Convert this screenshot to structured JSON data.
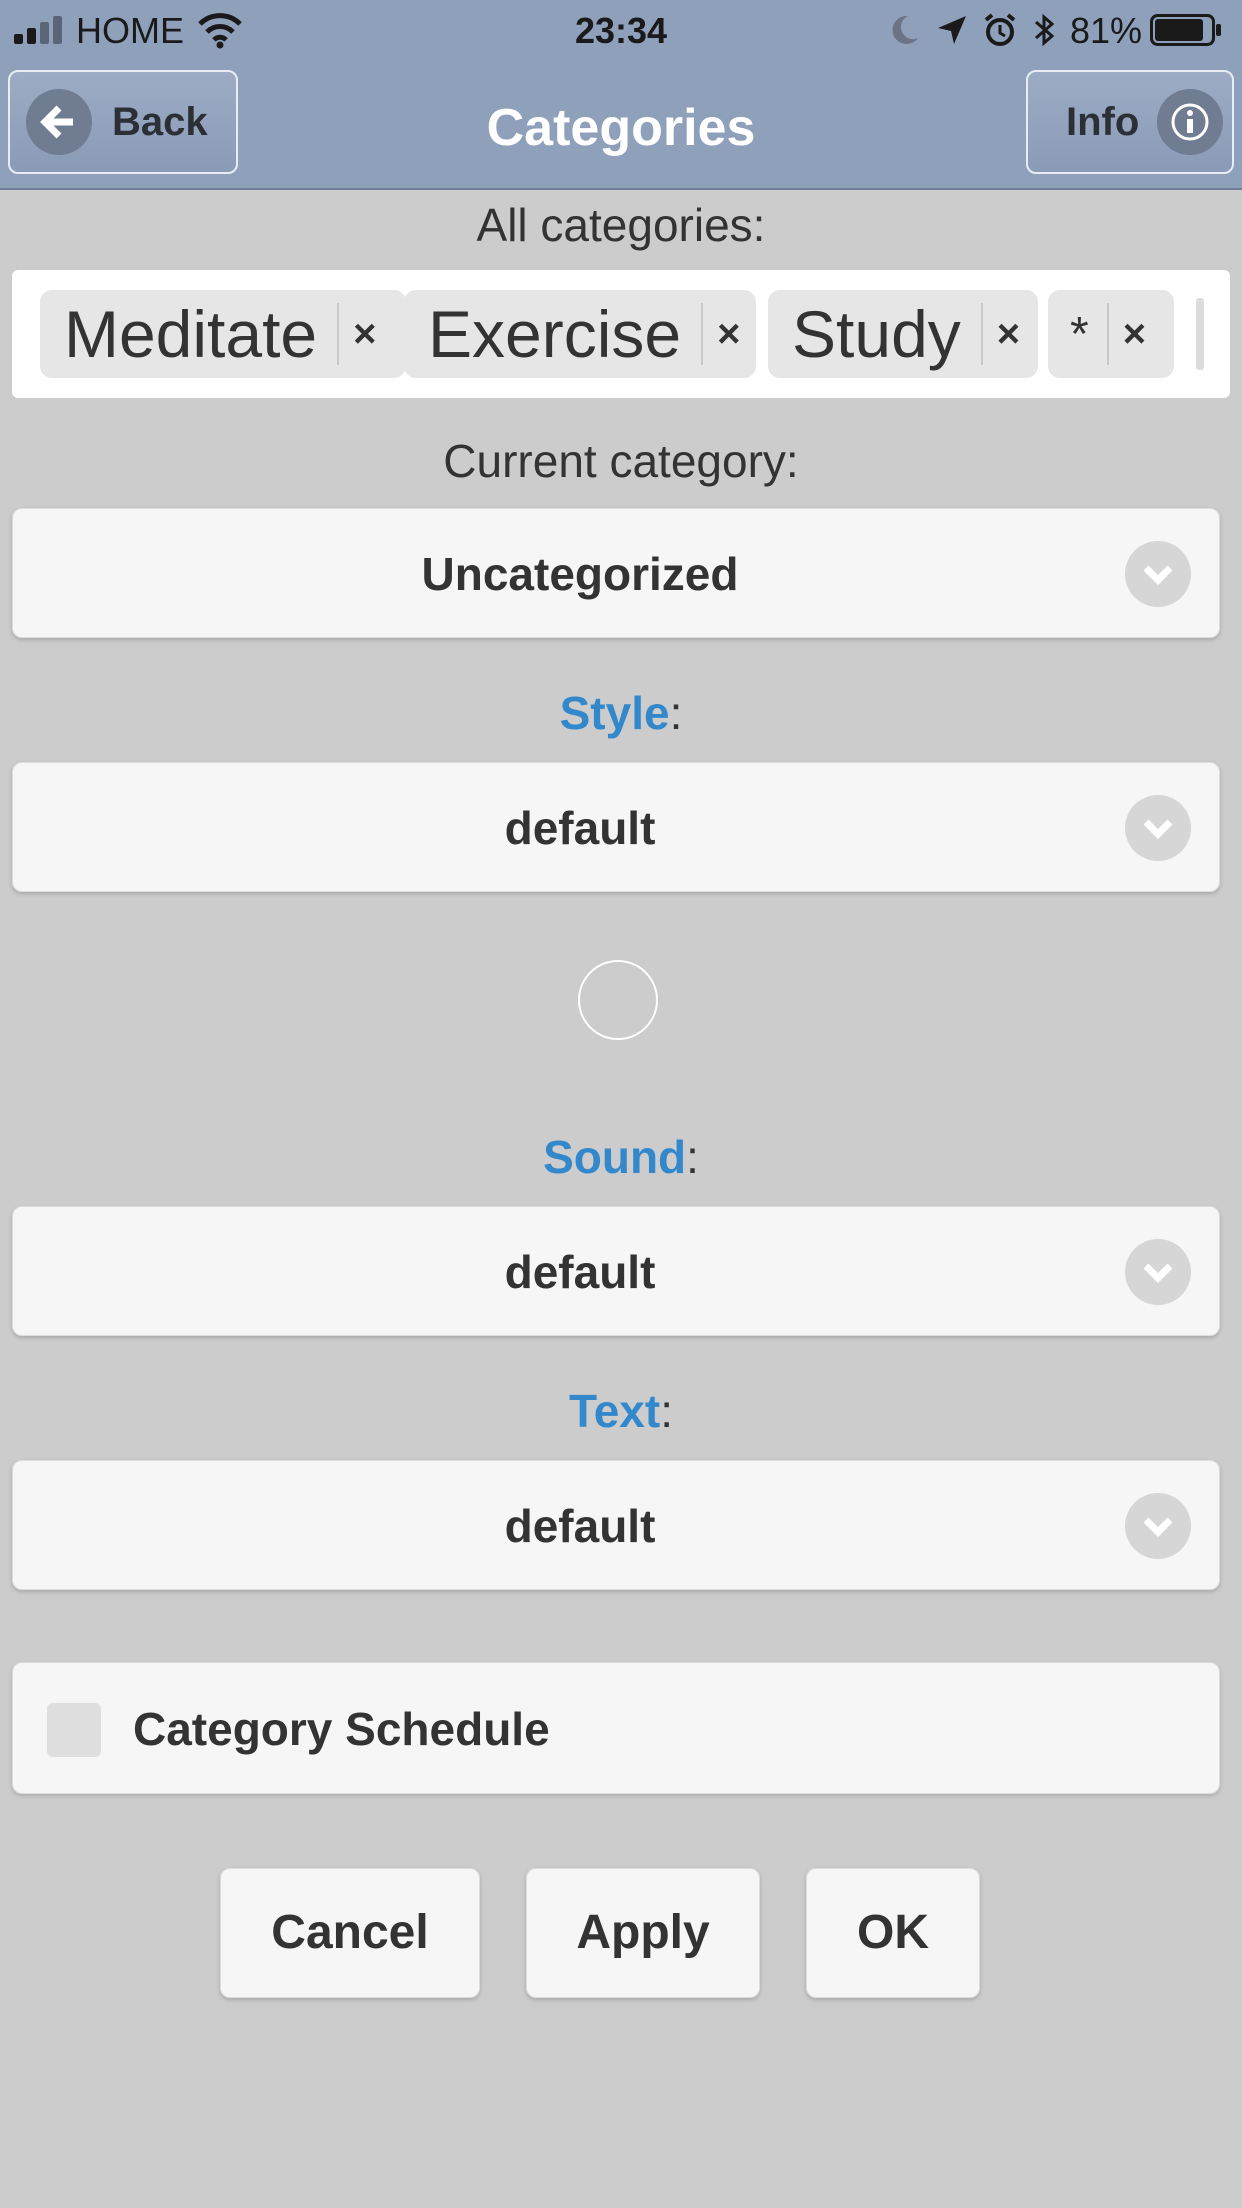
{
  "status_bar": {
    "carrier": "HOME",
    "time": "23:34",
    "battery_pct": "81%"
  },
  "header": {
    "back_label": "Back",
    "title": "Categories",
    "info_label": "Info"
  },
  "all_categories": {
    "label": "All categories:",
    "tags": [
      {
        "text": "Meditate",
        "remove": "×"
      },
      {
        "text": "Exercise",
        "remove": "×"
      },
      {
        "text": "Study",
        "remove": "×"
      },
      {
        "text": "*",
        "remove": "×"
      }
    ]
  },
  "current_category": {
    "label": "Current category:",
    "value": "Uncategorized"
  },
  "style": {
    "label": "Style",
    "colon": ":",
    "value": "default"
  },
  "sound": {
    "label": "Sound",
    "colon": ":",
    "value": "default"
  },
  "text": {
    "label": "Text",
    "colon": ":",
    "value": "default"
  },
  "schedule": {
    "label": "Category Schedule",
    "checked": false
  },
  "actions": {
    "cancel": "Cancel",
    "apply": "Apply",
    "ok": "OK"
  },
  "colors": {
    "header_bg": "#8fa0bb",
    "accent": "#3388cc",
    "page_bg": "#cccccc"
  }
}
